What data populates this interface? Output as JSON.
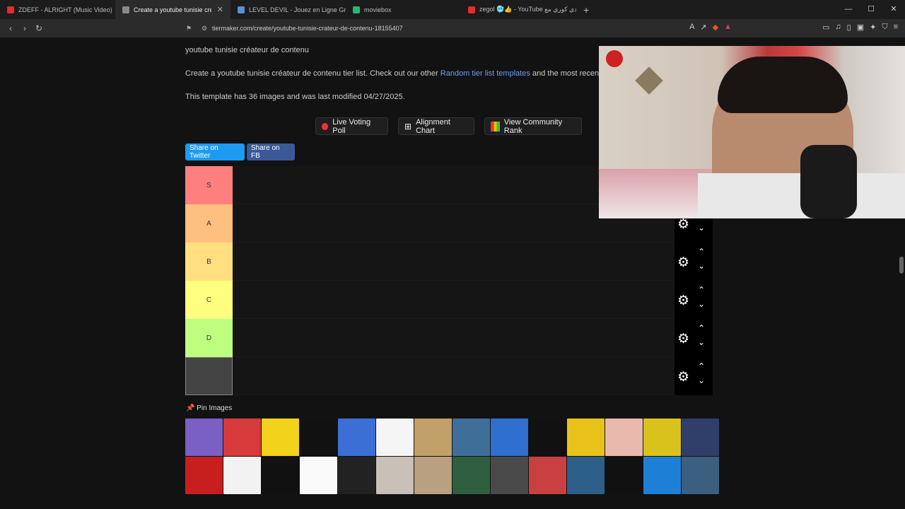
{
  "browser": {
    "tabs": [
      {
        "title": "ZDEFF - ALRIGHT (Music Video)",
        "color": "#e62b2b"
      },
      {
        "title": "Create a youtube tunisie créateur",
        "color": "#888888"
      },
      {
        "title": "LEVEL DEVIL - Jouez en Ligne Gratuit",
        "color": "#5a8fd6"
      },
      {
        "title": "moviebox",
        "color": "#2bb673"
      },
      {
        "title": "zegol 🥶👍 - YouTube تحدي كوري مع",
        "color": "#e62b2b"
      }
    ],
    "url": "tiermaker.com/create/youtube-tunisie-crateur-de-contenu-18155407"
  },
  "page": {
    "title": "youtube tunisie créateur de contenu",
    "intro_before": "Create a youtube tunisie créateur de contenu tier list. Check out our other ",
    "intro_link": "Random tier list templates",
    "intro_after": " and the most recent",
    "meta": "This template has 36 images and was last modified 04/27/2025.",
    "buttons": {
      "poll": "Live Voting Poll",
      "alignment": "Alignment Chart",
      "community": "View Community Rank"
    },
    "share_twitter": "Share on Twitter",
    "share_fb": "Share on FB",
    "tiers": [
      {
        "label": "S",
        "color": "#ff7f7f"
      },
      {
        "label": "A",
        "color": "#ffbf7f"
      },
      {
        "label": "B",
        "color": "#ffdf7f"
      },
      {
        "label": "C",
        "color": "#ffff7f"
      },
      {
        "label": "D",
        "color": "#bfff7f"
      },
      {
        "label": "",
        "color": "#444444"
      }
    ],
    "pin_label": "Pin Images",
    "image_colors": [
      "#7a5fc4",
      "#d63a3a",
      "#f2d21b",
      "#111111",
      "#3b6fd6",
      "#f5f5f5",
      "#c2a06a",
      "#3f6f99",
      "#2e6fcf",
      "#111111",
      "#e8c21a",
      "#e9b9b0",
      "#d9c21b",
      "#2f3f6a",
      "#c81e1e",
      "#f2f2f2",
      "#111111",
      "#fafafa",
      "#222222",
      "#c9c0b8",
      "#b8a080",
      "#2f5f3f",
      "#4a4a4a",
      "#c84040",
      "#2d5f8a",
      "#111111",
      "#1e7fd6",
      "#3a5f7f"
    ]
  }
}
